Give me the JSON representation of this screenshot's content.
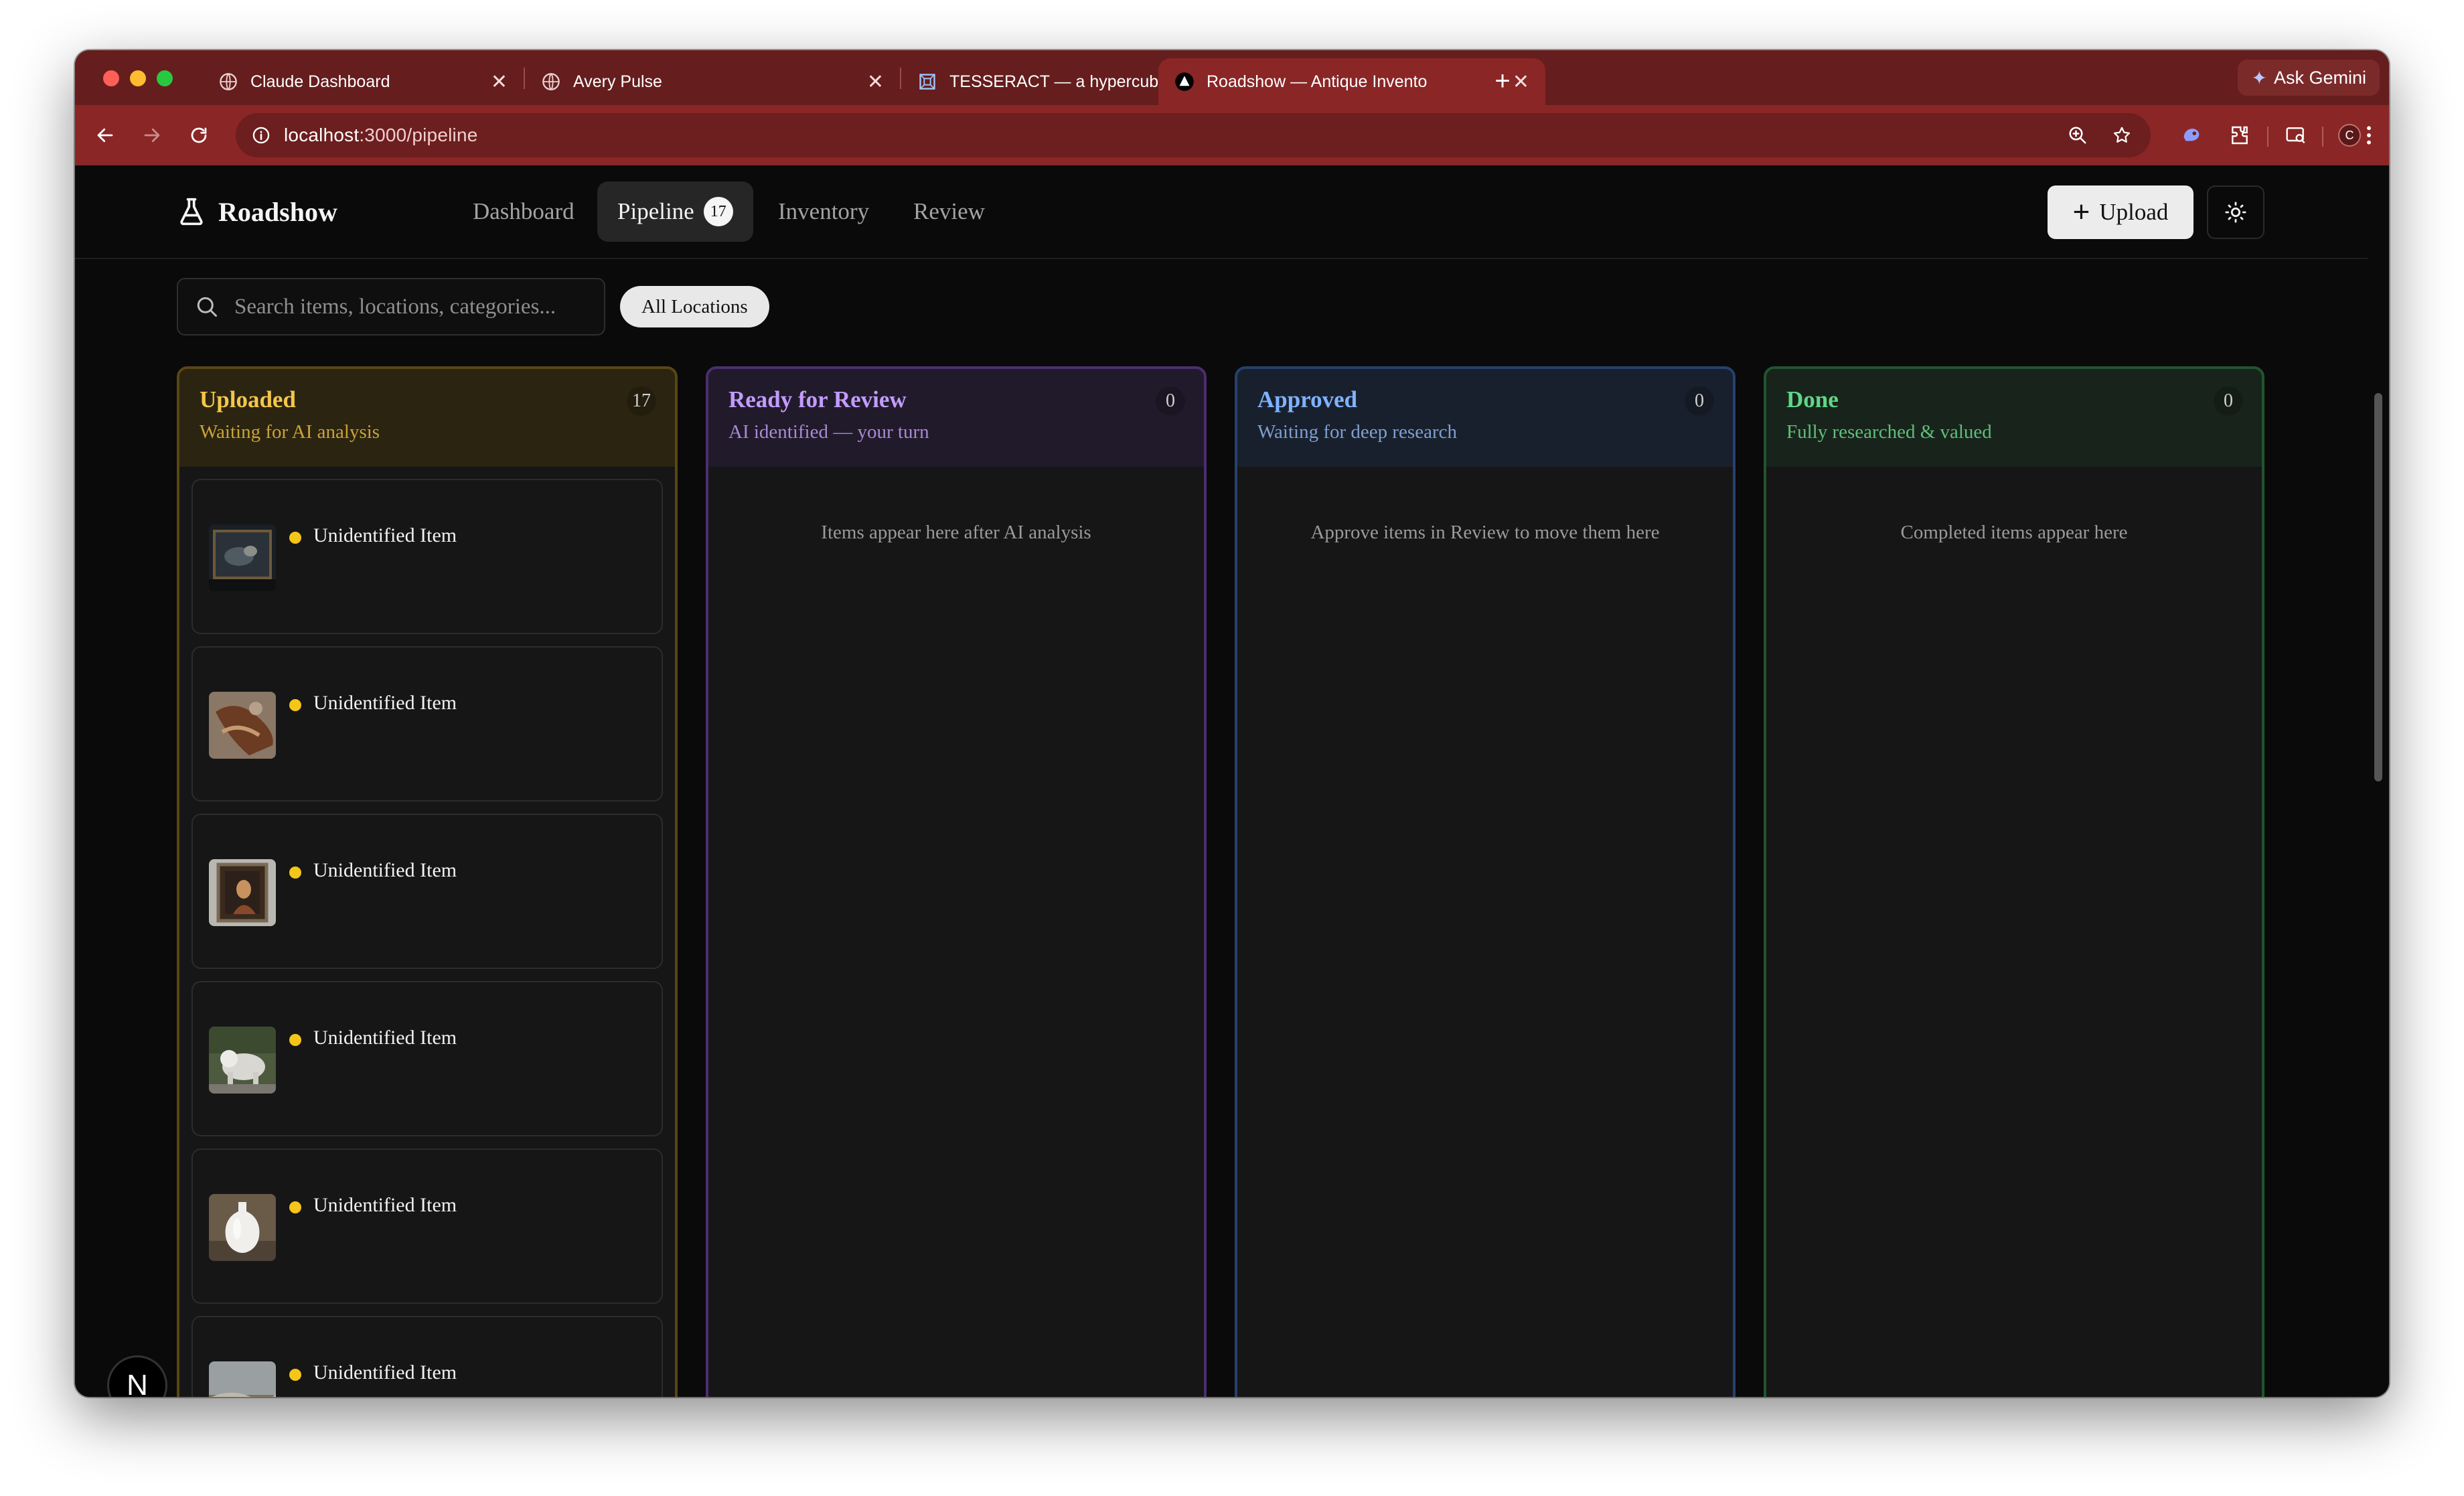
{
  "browser": {
    "tabs": [
      {
        "title": "Claude Dashboard",
        "active": false
      },
      {
        "title": "Avery Pulse",
        "active": false
      },
      {
        "title": "TESSERACT — a hypercube y",
        "active": false
      },
      {
        "title": "Roadshow — Antique Invento",
        "active": true
      }
    ],
    "new_tab_label": "+",
    "ask_gemini_label": "Ask Gemini",
    "url_host": "localhost",
    "url_path": ":3000/pipeline",
    "profile_initial": "C"
  },
  "app": {
    "brand": "Roadshow",
    "nav": [
      {
        "label": "Dashboard",
        "active": false
      },
      {
        "label": "Pipeline",
        "active": true,
        "badge": "17"
      },
      {
        "label": "Inventory",
        "active": false
      },
      {
        "label": "Review",
        "active": false
      }
    ],
    "upload_label": "Upload",
    "search_placeholder": "Search items, locations, categories...",
    "location_filter": "All Locations"
  },
  "columns": [
    {
      "title": "Uploaded",
      "subtitle": "Waiting for AI analysis",
      "count": "17",
      "accent": "#f3c64a",
      "items": [
        {
          "title": "Unidentified Item",
          "thumb": "dark-painting"
        },
        {
          "title": "Unidentified Item",
          "thumb": "leather-object"
        },
        {
          "title": "Unidentified Item",
          "thumb": "framed-portrait"
        },
        {
          "title": "Unidentified Item",
          "thumb": "stone-lion"
        },
        {
          "title": "Unidentified Item",
          "thumb": "white-vase"
        },
        {
          "title": "Unidentified Item",
          "thumb": "landscape-painting"
        }
      ]
    },
    {
      "title": "Ready for Review",
      "subtitle": "AI identified — your turn",
      "count": "0",
      "accent": "#c29cff",
      "empty_text": "Items appear here after AI analysis"
    },
    {
      "title": "Approved",
      "subtitle": "Waiting for deep research",
      "count": "0",
      "accent": "#7fb2ff",
      "empty_text": "Approve items in Review to move them here"
    },
    {
      "title": "Done",
      "subtitle": "Fully researched & valued",
      "count": "0",
      "accent": "#5fd787",
      "empty_text": "Completed items appear here"
    }
  ],
  "dev_badge": "N"
}
